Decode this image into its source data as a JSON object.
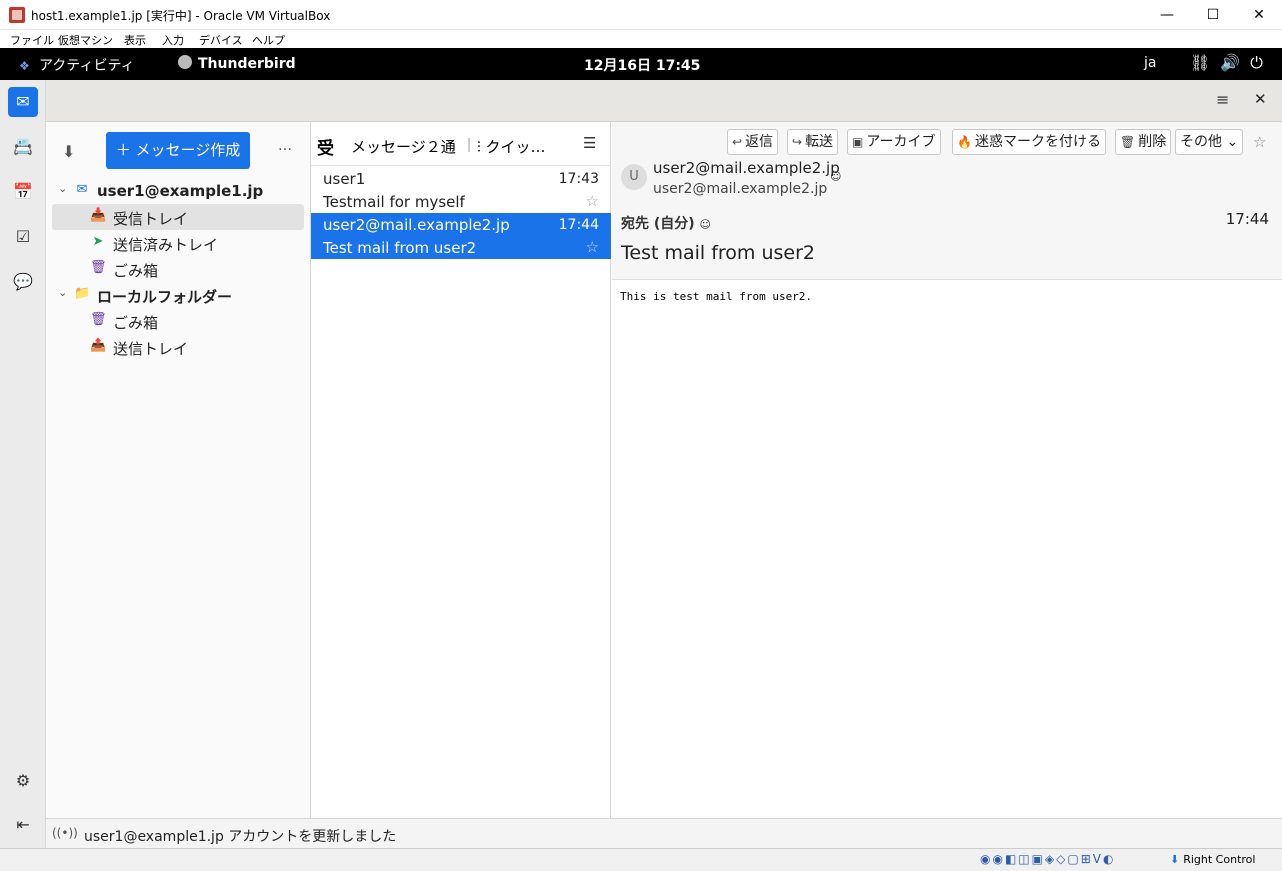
{
  "window": {
    "title": "host1.example1.jp [実行中] - Oracle VM VirtualBox",
    "minimize_icon": "minimize-icon",
    "maximize_icon": "maximize-icon",
    "close_icon": "close-icon",
    "min_glyph": "—",
    "max_glyph": "☐",
    "close_glyph": "✕"
  },
  "vbox_menu": [
    "ファイル",
    "仮想マシン",
    "表示",
    "入力",
    "デバイス",
    "ヘルプ"
  ],
  "gnome": {
    "activities": "アクティビティ",
    "app": "Thunderbird",
    "clock": "12月16日  17:45",
    "lang": "ja",
    "tray": "⛓🔊⏻"
  },
  "spaces": {
    "mail": "✉",
    "address_book": "📇",
    "calendar": "📅",
    "tasks": "☑",
    "chat": "💬",
    "settings": "⚙",
    "collapse": "⇤"
  },
  "toolbar": {
    "menu": "≡",
    "close": "✕"
  },
  "folder_pane": {
    "get_mail_icon": "⬇",
    "compose_label": "＋ メッセージ作成",
    "more": "…",
    "folders": [
      {
        "label": "user1@example1.jp",
        "icon": "✉",
        "kind": "account",
        "twisty": "⌄"
      },
      {
        "label": "受信トレイ",
        "icon": "📥",
        "kind": "folder"
      },
      {
        "label": "送信済みトレイ",
        "icon": "➤",
        "kind": "folder"
      },
      {
        "label": "ごみ箱",
        "icon": "🗑",
        "kind": "folder"
      },
      {
        "label": "ローカルフォルダー",
        "icon": "📁",
        "kind": "account",
        "twisty": "⌄"
      },
      {
        "label": "ごみ箱",
        "icon": "🗑",
        "kind": "folder"
      },
      {
        "label": "送信トレイ",
        "icon": "📤",
        "kind": "folder"
      }
    ]
  },
  "thread_pane": {
    "folder_glyph": "受",
    "count": "メッセージ２通",
    "quick_filter": "⫶ クイッ…",
    "display_options": "☰",
    "messages": [
      {
        "from": "user1",
        "time": "17:43",
        "subject": "Testmail for myself",
        "star": "☆"
      },
      {
        "from": "user2@mail.example2.jp",
        "time": "17:44",
        "subject": "Test mail from user2",
        "star": "☆"
      }
    ]
  },
  "message_pane": {
    "buttons": [
      {
        "icon": "↩",
        "label": "返信"
      },
      {
        "icon": "↪",
        "label": "転送"
      },
      {
        "icon": "▣",
        "label": "アーカイブ"
      },
      {
        "icon": "🔥",
        "label": "迷惑マークを付ける"
      },
      {
        "icon": "🗑",
        "label": "削除"
      },
      {
        "icon": "",
        "label": "その他 ⌄"
      }
    ],
    "star": "☆",
    "avatar_letter": "U",
    "from_name": "user2@mail.example2.jp",
    "from_address": "user2@mail.example2.jp",
    "address_badge": "☺",
    "to": "宛先  (自分)",
    "date": "17:44",
    "subject": "Test mail from user2",
    "body": "This is test mail from user2."
  },
  "status_bar": {
    "icon": "((•))",
    "text": "user1@example1.jp アカウントを更新しました"
  },
  "vbox_status": {
    "icons": "◉◉◧◫▣◈◇▢⊞V◐",
    "host_key": "Right Control",
    "host_key_arrow": "⬇"
  }
}
